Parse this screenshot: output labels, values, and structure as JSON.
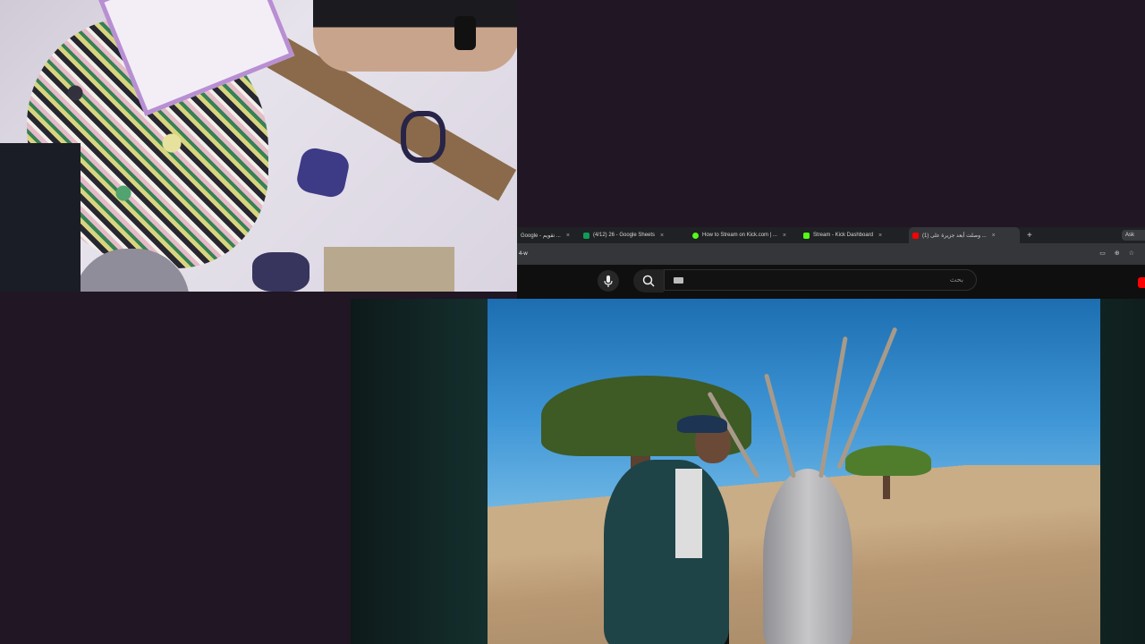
{
  "browser": {
    "tabs": [
      {
        "label": "Google - تقويم ...",
        "favicon_color": "#4285f4",
        "active": false
      },
      {
        "label": "(4/12) 26 - Google Sheets",
        "favicon_color": "#0f9d58",
        "active": false
      },
      {
        "label": "How to Stream on Kick.com | ...",
        "favicon_color": "#53fc18",
        "active": false
      },
      {
        "label": "Stream - Kick Dashboard",
        "favicon_color": "#53fc18",
        "active": false
      },
      {
        "label": "(1) وصلت أبعد جزيرة على ...",
        "favicon_color": "#ff0000",
        "active": true
      }
    ],
    "close_glyph": "×",
    "new_tab_glyph": "+",
    "ask_label": "Ask",
    "url": "4-w"
  },
  "youtube": {
    "search_placeholder": "بحث"
  },
  "colors": {
    "page_background": "#201624",
    "chrome_dark": "#202124",
    "youtube_red": "#ff0000"
  },
  "icons": {
    "mic": "microphone-icon",
    "search": "search-icon",
    "keyboard": "keyboard-icon"
  }
}
